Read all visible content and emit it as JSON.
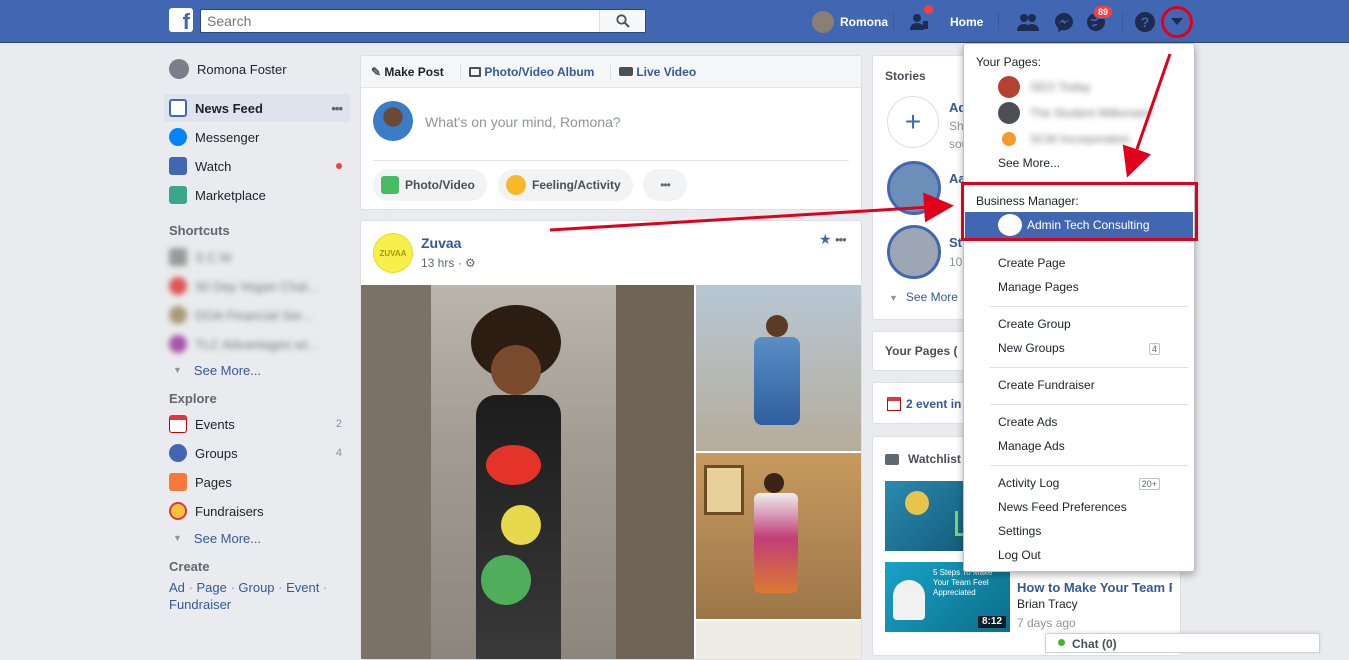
{
  "topbar": {
    "logo": "f",
    "search_placeholder": "Search",
    "user_name": "Romona",
    "home_label": "Home",
    "notifications_count": "89"
  },
  "sidebar": {
    "profile_name": "Romona Foster",
    "items": [
      {
        "label": "News Feed"
      },
      {
        "label": "Messenger"
      },
      {
        "label": "Watch"
      },
      {
        "label": "Marketplace"
      }
    ],
    "shortcuts_header": "Shortcuts",
    "shortcuts": [
      "S C M",
      "30 Day Vegan Chal...",
      "DOA Financial Ser...",
      "TLC Advantages wi..."
    ],
    "shortcuts_see_more": "See More...",
    "explore_header": "Explore",
    "explore": [
      {
        "label": "Events",
        "count": "2"
      },
      {
        "label": "Groups",
        "count": "4"
      },
      {
        "label": "Pages",
        "count": ""
      },
      {
        "label": "Fundraisers",
        "count": ""
      }
    ],
    "explore_see_more": "See More...",
    "create_header": "Create",
    "create_links": [
      "Ad",
      "Page",
      "Group",
      "Event",
      "Fundraiser"
    ]
  },
  "composer": {
    "tabs": [
      "Make Post",
      "Photo/Video Album",
      "Live Video"
    ],
    "placeholder": "What's on your mind, Romona?",
    "actions": [
      "Photo/Video",
      "Feeling/Activity"
    ],
    "more": "•••"
  },
  "post": {
    "author": "Zuvaa",
    "avatar_text": "ZUVAA",
    "time": "13 hrs",
    "more": "•••"
  },
  "right": {
    "stories_header": "Stories",
    "stories": [
      {
        "name": "Ad",
        "sub": "Sh"
      },
      {
        "name": "Aa",
        "sub": ""
      },
      {
        "name": "St",
        "sub": "10"
      }
    ],
    "stories_extra": "sou",
    "see_more": "See More",
    "your_pages": "Your Pages (",
    "events": "2 event in",
    "watchlist": "Watchlist",
    "video2_title": "How to Make Your Team Feel Appreciated | Bri...",
    "video2_author": "Brian Tracy",
    "video2_time": "7 days ago",
    "video2_duration": "8:12",
    "video2_thumb_text": "5 Steps To Make Your Team Feel Appreciated"
  },
  "dropdown": {
    "your_pages_label": "Your Pages:",
    "pages": [
      "SEO Today",
      "The Student Millionaire",
      "SCM Incorporation"
    ],
    "see_more": "See More...",
    "business_manager_label": "Business Manager:",
    "business_account": "Admin Tech Consulting",
    "items": [
      {
        "label": "Create Page"
      },
      {
        "label": "Manage Pages"
      },
      {
        "label": "Create Group"
      },
      {
        "label": "New Groups",
        "count": "4"
      },
      {
        "label": "Create Fundraiser"
      },
      {
        "label": "Create Ads"
      },
      {
        "label": "Manage Ads"
      },
      {
        "label": "Activity Log",
        "count": "20+"
      },
      {
        "label": "News Feed Preferences"
      },
      {
        "label": "Settings"
      },
      {
        "label": "Log Out"
      }
    ]
  },
  "chat": {
    "label": "Chat (0)"
  },
  "colors": {
    "brand": "#4267b2",
    "link": "#365899",
    "annotation": "#e0001b"
  }
}
